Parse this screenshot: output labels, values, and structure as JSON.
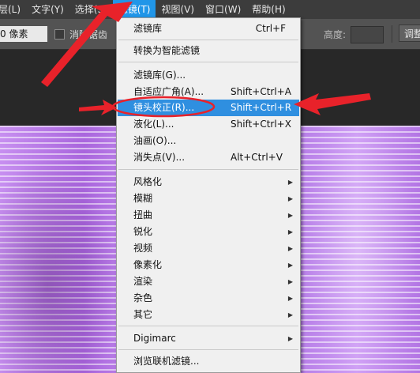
{
  "menubar": {
    "items": [
      {
        "label": "层(L)"
      },
      {
        "label": "文字(Y)"
      },
      {
        "label": "选择(S)"
      },
      {
        "label": "滤镜(T)",
        "active": true
      },
      {
        "label": "视图(V)"
      },
      {
        "label": "窗口(W)"
      },
      {
        "label": "帮助(H)"
      }
    ]
  },
  "options": {
    "feather_value": "0 像素",
    "antialias_label": "消除锯齿",
    "height_label": "高度:",
    "adjust_label": "调整"
  },
  "filter_menu": {
    "items": [
      {
        "label": "滤镜库",
        "shortcut": "Ctrl+F"
      },
      {
        "label": "转换为智能滤镜",
        "shortcut": ""
      },
      {
        "label": "滤镜库(G)...",
        "shortcut": ""
      },
      {
        "label": "自适应广角(A)...",
        "shortcut": "Shift+Ctrl+A"
      },
      {
        "label": "镜头校正(R)...",
        "shortcut": "Shift+Ctrl+R",
        "highlighted": true
      },
      {
        "label": "液化(L)...",
        "shortcut": "Shift+Ctrl+X"
      },
      {
        "label": "油画(O)...",
        "shortcut": ""
      },
      {
        "label": "消失点(V)...",
        "shortcut": "Alt+Ctrl+V"
      },
      {
        "label": "风格化",
        "submenu": true
      },
      {
        "label": "模糊",
        "submenu": true
      },
      {
        "label": "扭曲",
        "submenu": true
      },
      {
        "label": "锐化",
        "submenu": true
      },
      {
        "label": "视频",
        "submenu": true
      },
      {
        "label": "像素化",
        "submenu": true
      },
      {
        "label": "渲染",
        "submenu": true
      },
      {
        "label": "杂色",
        "submenu": true
      },
      {
        "label": "其它",
        "submenu": true
      },
      {
        "label": "Digimarc",
        "submenu": true
      },
      {
        "label": "浏览联机滤镜...",
        "shortcut": ""
      }
    ]
  },
  "colors": {
    "menu_highlight": "#2f8fe0",
    "annotation_red": "#e8222a",
    "canvas_purple": "#b47ae6"
  },
  "icons": {
    "submenu_arrow": "triangle-right"
  }
}
